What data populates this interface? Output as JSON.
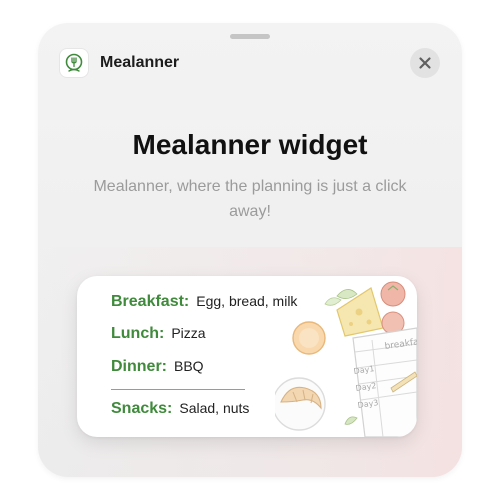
{
  "app": {
    "name": "Mealanner",
    "icon": "fork-plate-icon"
  },
  "header": {
    "close_icon": "close-icon"
  },
  "main": {
    "title": "Mealanner widget",
    "subtitle": "Mealanner, where the planning is just a click away!"
  },
  "widget": {
    "meals": [
      {
        "label": "Breakfast:",
        "value": "Egg, bread, milk"
      },
      {
        "label": "Lunch:",
        "value": "Pizza"
      },
      {
        "label": "Dinner:",
        "value": "BBQ"
      },
      {
        "label": "Snacks:",
        "value": "Salad, nuts"
      }
    ],
    "illustration": {
      "icon": "food-planner-illustration",
      "notes": [
        "breakfast",
        "Day1",
        "Day2",
        "Day3"
      ]
    }
  },
  "colors": {
    "accent": "#3f8a3b",
    "title": "#111111",
    "subtitle": "#9b9b9b"
  }
}
